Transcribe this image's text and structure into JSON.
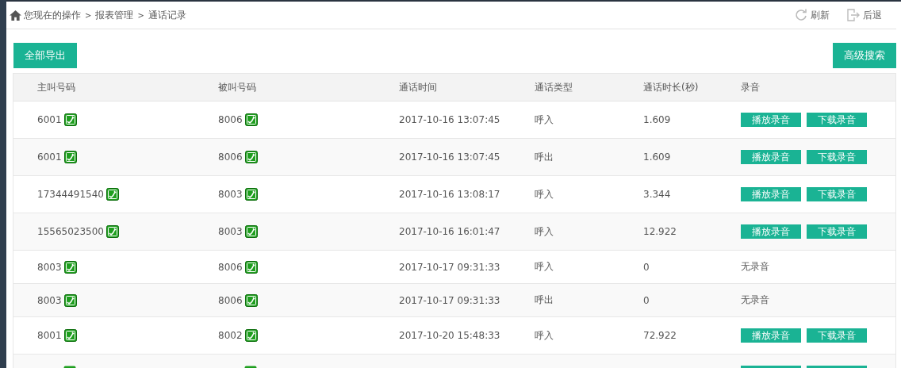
{
  "breadcrumb": {
    "items": [
      "您现在的操作",
      "报表管理",
      "通话记录"
    ],
    "separator": ">"
  },
  "top_actions": [
    {
      "kind": "refresh",
      "label": "刷新"
    },
    {
      "kind": "back",
      "label": "后退"
    }
  ],
  "toolbar": {
    "export_button": "全部导出",
    "search_button": "高级搜索"
  },
  "table": {
    "columns": [
      "主叫号码",
      "被叫号码",
      "通话时间",
      "通话类型",
      "通话时长(秒)",
      "录音"
    ],
    "rows": [
      {
        "caller": "6001",
        "callee": "8006",
        "time": "2017-10-16 13:07:45",
        "type": "呼入",
        "duration": "1.609",
        "recording": {
          "kind": "buttons",
          "play": "播放录音",
          "download": "下载录音"
        }
      },
      {
        "caller": "6001",
        "callee": "8006",
        "time": "2017-10-16 13:07:45",
        "type": "呼出",
        "duration": "1.609",
        "recording": {
          "kind": "buttons",
          "play": "播放录音",
          "download": "下载录音"
        }
      },
      {
        "caller": "17344491540",
        "callee": "8003",
        "time": "2017-10-16 13:08:17",
        "type": "呼入",
        "duration": "3.344",
        "recording": {
          "kind": "buttons",
          "play": "播放录音",
          "download": "下载录音"
        }
      },
      {
        "caller": "15565023500",
        "callee": "8003",
        "time": "2017-10-16 16:01:47",
        "type": "呼入",
        "duration": "12.922",
        "recording": {
          "kind": "buttons",
          "play": "播放录音",
          "download": "下载录音"
        }
      },
      {
        "caller": "8003",
        "callee": "8006",
        "time": "2017-10-17 09:31:33",
        "type": "呼入",
        "duration": "0",
        "recording": {
          "kind": "none",
          "text": "无录音"
        }
      },
      {
        "caller": "8003",
        "callee": "8006",
        "time": "2017-10-17 09:31:33",
        "type": "呼出",
        "duration": "0",
        "recording": {
          "kind": "none",
          "text": "无录音"
        }
      },
      {
        "caller": "8001",
        "callee": "8002",
        "time": "2017-10-20 15:48:33",
        "type": "呼入",
        "duration": "72.922",
        "recording": {
          "kind": "buttons",
          "play": "播放录音",
          "download": "下载录音"
        }
      }
    ],
    "cut_row": {
      "recording": true
    }
  }
}
